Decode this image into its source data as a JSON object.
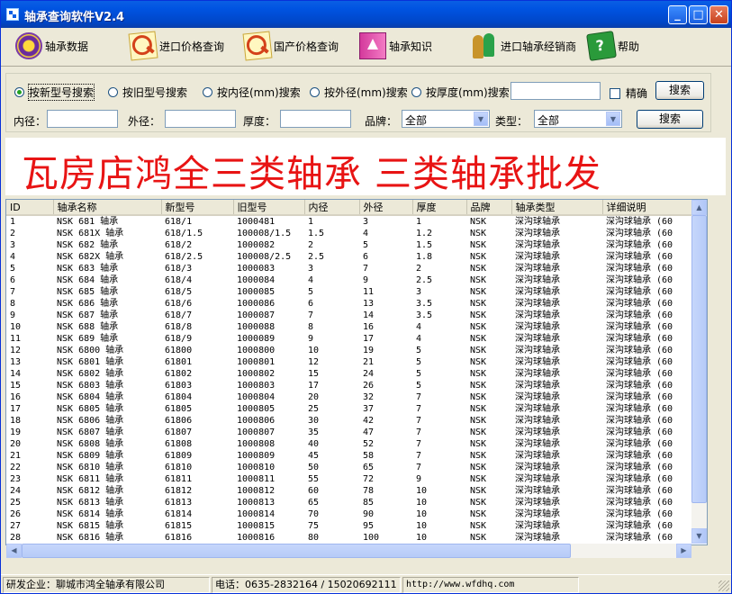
{
  "window": {
    "title": "轴承查询软件V2.4"
  },
  "toolbar": {
    "items": [
      {
        "label": "轴承数据",
        "icon": "bearing-disc-icon"
      },
      {
        "label": "进口价格查询",
        "icon": "price-search-icon"
      },
      {
        "label": "国产价格查询",
        "icon": "price-search-icon"
      },
      {
        "label": "轴承知识",
        "icon": "knowledge-book-icon"
      },
      {
        "label": "进口轴承经销商",
        "icon": "dealers-icon"
      },
      {
        "label": "帮助",
        "icon": "help-book-icon"
      }
    ]
  },
  "search": {
    "modes": [
      "按新型号搜索",
      "按旧型号搜索",
      "按内径(mm)搜索",
      "按外径(mm)搜索",
      "按厚度(mm)搜索"
    ],
    "selected_mode": 0,
    "keyword_value": "",
    "exact_label": "精确",
    "search_btn_1": "搜索",
    "inner_label": "内径：",
    "outer_label": "外径：",
    "thick_label": "厚度：",
    "brand_label": "品牌：",
    "brand_value": "全部",
    "type_label": "类型：",
    "type_value": "全部",
    "search_btn_2": "搜索"
  },
  "banner": {
    "text": "瓦房店鸿全三类轴承  三类轴承批发",
    "color": "#e81414"
  },
  "table": {
    "columns": [
      "ID",
      "轴承名称",
      "新型号",
      "旧型号",
      "内径",
      "外径",
      "厚度",
      "品牌",
      "轴承类型",
      "详细说明"
    ],
    "rows": [
      [
        "1",
        "NSK 681 轴承",
        "618/1",
        "1000481",
        "1",
        "3",
        "1",
        "NSK",
        "深沟球轴承",
        "深沟球轴承 (60"
      ],
      [
        "2",
        "NSK 681X 轴承",
        "618/1.5",
        "100008/1.5",
        "1.5",
        "4",
        "1.2",
        "NSK",
        "深沟球轴承",
        "深沟球轴承 (60"
      ],
      [
        "3",
        "NSK 682 轴承",
        "618/2",
        "1000082",
        "2",
        "5",
        "1.5",
        "NSK",
        "深沟球轴承",
        "深沟球轴承 (60"
      ],
      [
        "4",
        "NSK 682X 轴承",
        "618/2.5",
        "100008/2.5",
        "2.5",
        "6",
        "1.8",
        "NSK",
        "深沟球轴承",
        "深沟球轴承 (60"
      ],
      [
        "5",
        "NSK 683 轴承",
        "618/3",
        "1000083",
        "3",
        "7",
        "2",
        "NSK",
        "深沟球轴承",
        "深沟球轴承 (60"
      ],
      [
        "6",
        "NSK 684 轴承",
        "618/4",
        "1000084",
        "4",
        "9",
        "2.5",
        "NSK",
        "深沟球轴承",
        "深沟球轴承 (60"
      ],
      [
        "7",
        "NSK 685 轴承",
        "618/5",
        "1000085",
        "5",
        "11",
        "3",
        "NSK",
        "深沟球轴承",
        "深沟球轴承 (60"
      ],
      [
        "8",
        "NSK 686 轴承",
        "618/6",
        "1000086",
        "6",
        "13",
        "3.5",
        "NSK",
        "深沟球轴承",
        "深沟球轴承 (60"
      ],
      [
        "9",
        "NSK 687 轴承",
        "618/7",
        "1000087",
        "7",
        "14",
        "3.5",
        "NSK",
        "深沟球轴承",
        "深沟球轴承 (60"
      ],
      [
        "10",
        "NSK 688 轴承",
        "618/8",
        "1000088",
        "8",
        "16",
        "4",
        "NSK",
        "深沟球轴承",
        "深沟球轴承 (60"
      ],
      [
        "11",
        "NSK 689 轴承",
        "618/9",
        "1000089",
        "9",
        "17",
        "4",
        "NSK",
        "深沟球轴承",
        "深沟球轴承 (60"
      ],
      [
        "12",
        "NSK 6800 轴承",
        "61800",
        "1000800",
        "10",
        "19",
        "5",
        "NSK",
        "深沟球轴承",
        "深沟球轴承 (60"
      ],
      [
        "13",
        "NSK 6801 轴承",
        "61801",
        "1000801",
        "12",
        "21",
        "5",
        "NSK",
        "深沟球轴承",
        "深沟球轴承 (60"
      ],
      [
        "14",
        "NSK 6802 轴承",
        "61802",
        "1000802",
        "15",
        "24",
        "5",
        "NSK",
        "深沟球轴承",
        "深沟球轴承 (60"
      ],
      [
        "15",
        "NSK 6803 轴承",
        "61803",
        "1000803",
        "17",
        "26",
        "5",
        "NSK",
        "深沟球轴承",
        "深沟球轴承 (60"
      ],
      [
        "16",
        "NSK 6804 轴承",
        "61804",
        "1000804",
        "20",
        "32",
        "7",
        "NSK",
        "深沟球轴承",
        "深沟球轴承 (60"
      ],
      [
        "17",
        "NSK 6805 轴承",
        "61805",
        "1000805",
        "25",
        "37",
        "7",
        "NSK",
        "深沟球轴承",
        "深沟球轴承 (60"
      ],
      [
        "18",
        "NSK 6806 轴承",
        "61806",
        "1000806",
        "30",
        "42",
        "7",
        "NSK",
        "深沟球轴承",
        "深沟球轴承 (60"
      ],
      [
        "19",
        "NSK 6807 轴承",
        "61807",
        "1000807",
        "35",
        "47",
        "7",
        "NSK",
        "深沟球轴承",
        "深沟球轴承 (60"
      ],
      [
        "20",
        "NSK 6808 轴承",
        "61808",
        "1000808",
        "40",
        "52",
        "7",
        "NSK",
        "深沟球轴承",
        "深沟球轴承 (60"
      ],
      [
        "21",
        "NSK 6809 轴承",
        "61809",
        "1000809",
        "45",
        "58",
        "7",
        "NSK",
        "深沟球轴承",
        "深沟球轴承 (60"
      ],
      [
        "22",
        "NSK 6810 轴承",
        "61810",
        "1000810",
        "50",
        "65",
        "7",
        "NSK",
        "深沟球轴承",
        "深沟球轴承 (60"
      ],
      [
        "23",
        "NSK 6811 轴承",
        "61811",
        "1000811",
        "55",
        "72",
        "9",
        "NSK",
        "深沟球轴承",
        "深沟球轴承 (60"
      ],
      [
        "24",
        "NSK 6812 轴承",
        "61812",
        "1000812",
        "60",
        "78",
        "10",
        "NSK",
        "深沟球轴承",
        "深沟球轴承 (60"
      ],
      [
        "25",
        "NSK 6813 轴承",
        "61813",
        "1000813",
        "65",
        "85",
        "10",
        "NSK",
        "深沟球轴承",
        "深沟球轴承 (60"
      ],
      [
        "26",
        "NSK 6814 轴承",
        "61814",
        "1000814",
        "70",
        "90",
        "10",
        "NSK",
        "深沟球轴承",
        "深沟球轴承 (60"
      ],
      [
        "27",
        "NSK 6815 轴承",
        "61815",
        "1000815",
        "75",
        "95",
        "10",
        "NSK",
        "深沟球轴承",
        "深沟球轴承 (60"
      ],
      [
        "28",
        "NSK 6816 轴承",
        "61816",
        "1000816",
        "80",
        "100",
        "10",
        "NSK",
        "深沟球轴承",
        "深沟球轴承 (60"
      ]
    ]
  },
  "status": {
    "company": "研发企业：聊城市鸿全轴承有限公司",
    "phone": "电话：0635-2832164  /  15020692111",
    "url": "http://www.wfdhq.com"
  }
}
